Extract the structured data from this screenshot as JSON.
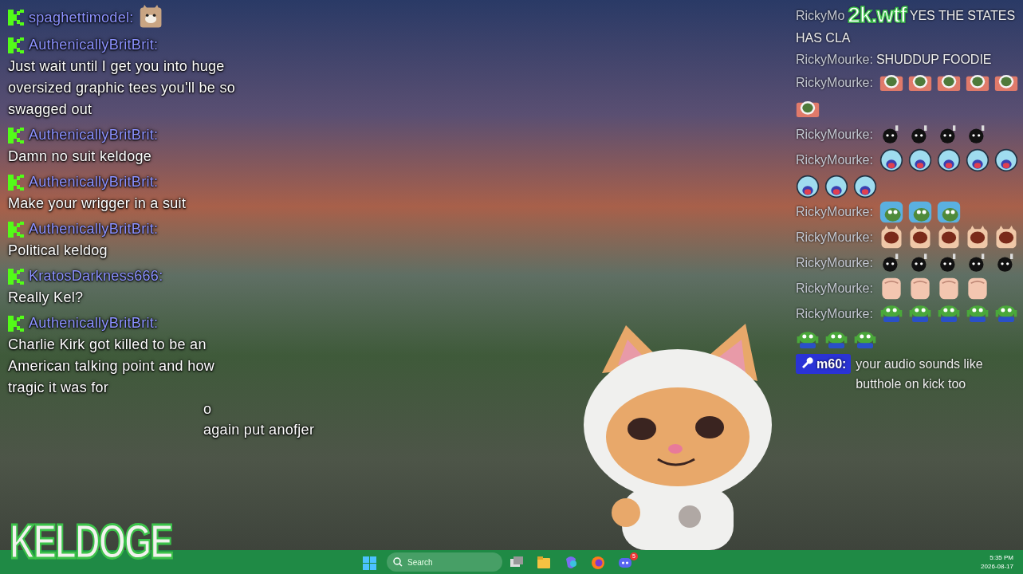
{
  "left_chat": [
    {
      "user": "spaghettimodel:",
      "emote": {
        "kind": "cat"
      }
    },
    {
      "user": "AuthenicallyBritBrit:",
      "text": "Just wait until I get you into huge oversized graphic tees you'll be so swagged out"
    },
    {
      "user": "AuthenicallyBritBrit:",
      "text": "Damn no suit keldoge"
    },
    {
      "user": "AuthenicallyBritBrit:",
      "text": "Make your wrigger in a suit"
    },
    {
      "user": "AuthenicallyBritBrit:",
      "text": "Political keldog"
    },
    {
      "user": "KratosDarkness666:",
      "text": "Really Kel?"
    },
    {
      "user": "AuthenicallyBritBrit:",
      "text": "Charlie Kirk got killed to be an American talking point and how tragic it was for",
      "tail": [
        "o",
        "again put anofjer"
      ]
    }
  ],
  "streamer_logo": "KELDOGE",
  "site_logo": "2k.wtf",
  "right_chat": [
    {
      "user": "RickyMo",
      "text": "YES THE STATES",
      "continuation": "HAS CLA"
    },
    {
      "user": "RickyMourke:",
      "text": "SHUDDUP FOODIE"
    },
    {
      "user": "RickyMourke:",
      "emotes": [
        {
          "kind": "pepe-box"
        },
        {
          "kind": "pepe-box"
        },
        {
          "kind": "pepe-box"
        },
        {
          "kind": "pepe-box"
        },
        {
          "kind": "pepe-box"
        },
        {
          "kind": "pepe-box"
        }
      ]
    },
    {
      "user": "RickyMourke:",
      "emotes": [
        {
          "kind": "bomb"
        },
        {
          "kind": "bomb"
        },
        {
          "kind": "bomb"
        },
        {
          "kind": "bomb"
        }
      ]
    },
    {
      "user": "RickyMourke:",
      "emotes": [
        {
          "kind": "shout-face"
        },
        {
          "kind": "shout-face"
        },
        {
          "kind": "shout-face"
        },
        {
          "kind": "shout-face"
        },
        {
          "kind": "shout-face"
        },
        {
          "kind": "shout-face"
        },
        {
          "kind": "shout-face"
        },
        {
          "kind": "shout-face"
        }
      ]
    },
    {
      "user": "RickyMourke:",
      "emotes": [
        {
          "kind": "pepe-blue"
        },
        {
          "kind": "pepe-blue"
        },
        {
          "kind": "pepe-blue"
        }
      ]
    },
    {
      "user": "RickyMourke:",
      "emotes": [
        {
          "kind": "cat-mouth"
        },
        {
          "kind": "cat-mouth"
        },
        {
          "kind": "cat-mouth"
        },
        {
          "kind": "cat-mouth"
        },
        {
          "kind": "cat-mouth"
        }
      ]
    },
    {
      "user": "RickyMourke:",
      "emotes": [
        {
          "kind": "bomb"
        },
        {
          "kind": "bomb"
        },
        {
          "kind": "bomb"
        },
        {
          "kind": "bomb"
        },
        {
          "kind": "bomb"
        }
      ]
    },
    {
      "user": "RickyMourke:",
      "emotes": [
        {
          "kind": "fist"
        },
        {
          "kind": "fist"
        },
        {
          "kind": "fist"
        },
        {
          "kind": "fist"
        }
      ]
    },
    {
      "user": "RickyMourke:",
      "emotes": [
        {
          "kind": "pepe-dance"
        },
        {
          "kind": "pepe-dance"
        },
        {
          "kind": "pepe-dance"
        },
        {
          "kind": "pepe-dance"
        },
        {
          "kind": "pepe-dance"
        },
        {
          "kind": "pepe-dance"
        },
        {
          "kind": "pepe-dance"
        },
        {
          "kind": "pepe-dance"
        }
      ]
    },
    {
      "user": "m60:",
      "badge": {
        "kind": "wrench"
      },
      "text": "your audio sounds like butthole on kick too"
    }
  ],
  "taskbar": {
    "search": {
      "placeholder": "Search"
    },
    "apps": [
      {
        "kind": "task-view"
      },
      {
        "kind": "folder"
      },
      {
        "kind": "copilot"
      },
      {
        "kind": "firefox"
      },
      {
        "kind": "discord",
        "badge": "5"
      }
    ],
    "time": "5:35 PM",
    "date": "2026-08-17"
  }
}
